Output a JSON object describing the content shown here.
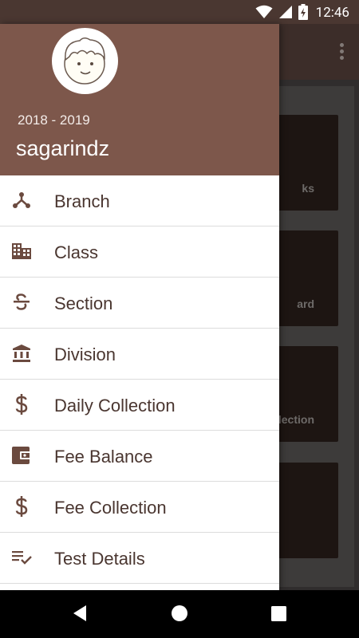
{
  "status_bar": {
    "time": "12:46",
    "icons": [
      "wifi-icon",
      "signal-icon",
      "battery-charging-icon"
    ]
  },
  "header": {
    "year": "2018 - 2019",
    "username": "sagarindz"
  },
  "menu": {
    "items": [
      {
        "label": "Branch",
        "icon": "branch-icon"
      },
      {
        "label": "Class",
        "icon": "building-icon"
      },
      {
        "label": "Section",
        "icon": "strikethrough-icon"
      },
      {
        "label": "Division",
        "icon": "bank-icon"
      },
      {
        "label": "Daily Collection",
        "icon": "dollar-icon"
      },
      {
        "label": "Fee Balance",
        "icon": "wallet-icon"
      },
      {
        "label": "Fee Collection",
        "icon": "dollar-icon"
      },
      {
        "label": "Test Details",
        "icon": "playlist-check-icon"
      }
    ]
  },
  "background_cards": [
    {
      "label": "ks"
    },
    {
      "label": "ard"
    },
    {
      "label": "llection"
    },
    {
      "label": ""
    }
  ],
  "colors": {
    "header_bg": "#7d574b",
    "icon": "#6b4a3f",
    "toolbar": "#5c4640"
  }
}
